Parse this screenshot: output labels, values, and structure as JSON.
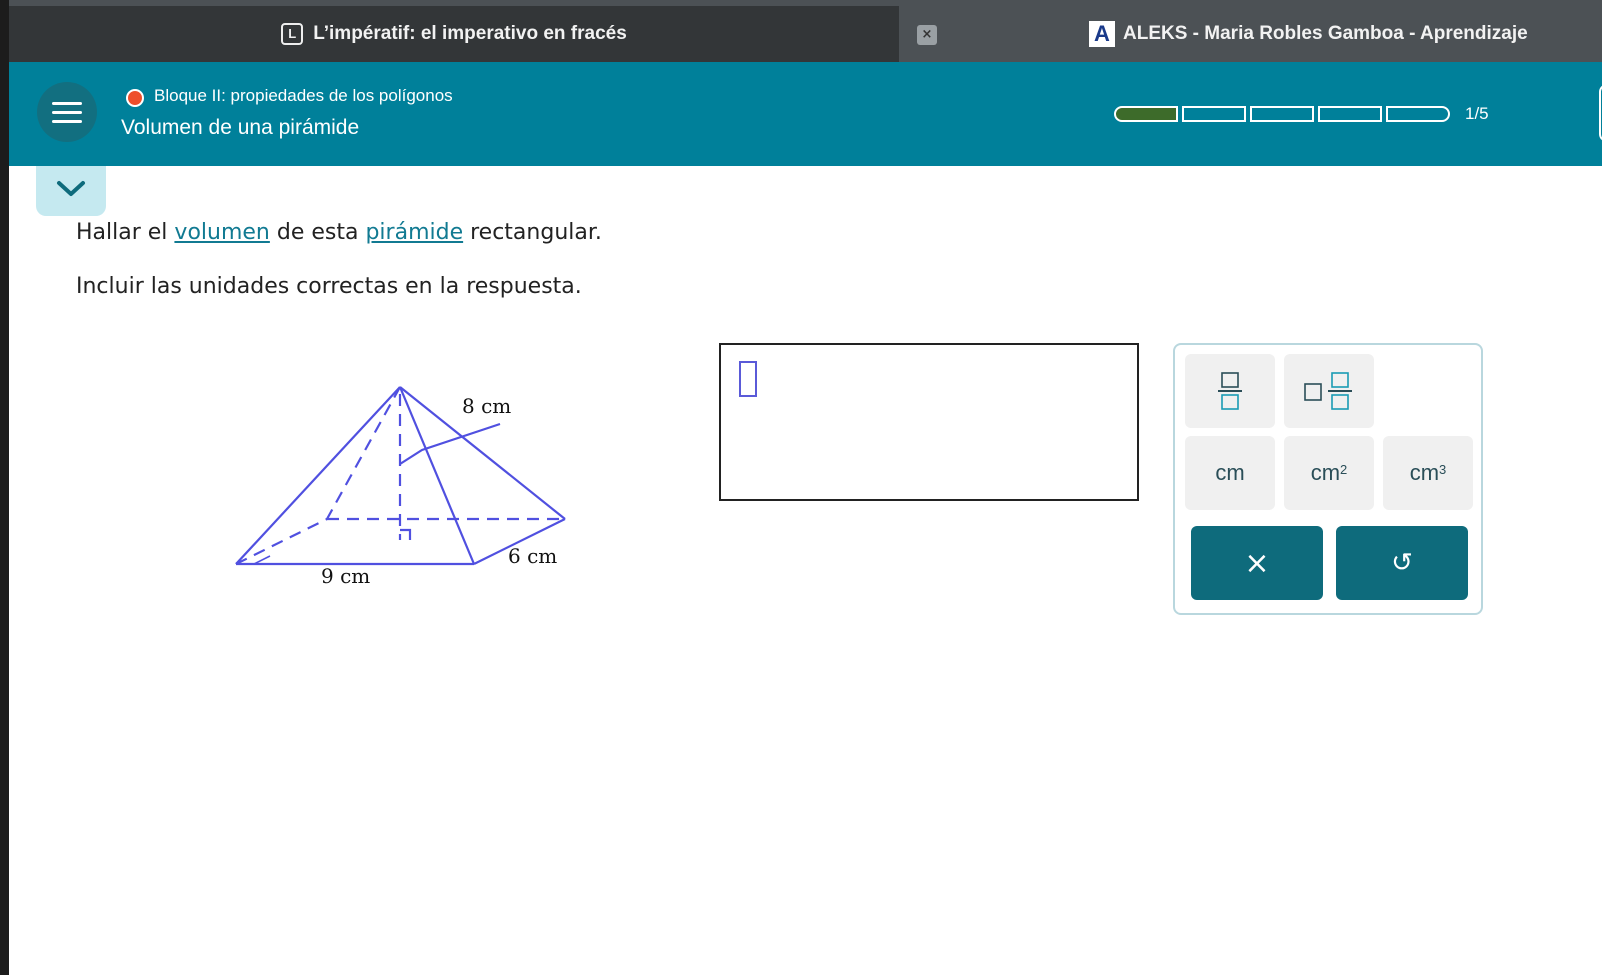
{
  "tabs": [
    {
      "icon": "L",
      "title": "L’impératif: el imperativo en fracés"
    },
    {
      "icon": "A",
      "title": "ALEKS - Maria Robles Gamboa - Aprendizaje"
    }
  ],
  "tab_close_glyph": "×",
  "header": {
    "topic_status_color": "#ee4e2b",
    "topic": "Bloque II: propiedades de los polígonos",
    "title": "Volumen de una pirámide",
    "progress": {
      "completed": 1,
      "total": 5,
      "label": "1/5"
    }
  },
  "problem": {
    "line1": {
      "pre": "Hallar el ",
      "link1": "volumen",
      "mid": " de esta ",
      "link2": "pirámide",
      "post": " rectangular."
    },
    "line2": "Incluir las unidades correctas en la respuesta."
  },
  "figure": {
    "labels": {
      "height": "8 cm",
      "length": "9 cm",
      "width": "6 cm"
    }
  },
  "answer": {
    "value": ""
  },
  "keypad": {
    "keys": [
      "fraction",
      "mixed-number",
      "cm",
      "cm",
      "cm"
    ],
    "unit_base": "cm",
    "exp2": "2",
    "exp3": "3",
    "clear_glyph": "×",
    "undo_glyph": "↺"
  },
  "colors": {
    "accent": "#00809a",
    "button": "#0e6b7c",
    "link": "#117a92",
    "figure_stroke": "#5050e0"
  }
}
